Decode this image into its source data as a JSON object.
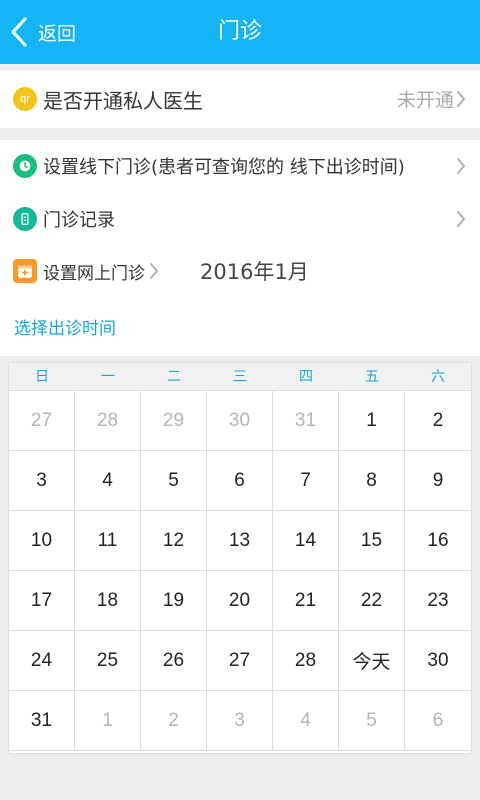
{
  "header": {
    "title": "门诊",
    "back_label": "返回"
  },
  "private_doctor": {
    "label": "是否开通私人医生",
    "status": "未开通",
    "icon_text": "qr"
  },
  "menu": {
    "offline_clinic": "设置线下门诊(患者可查询您的 线下出诊时间)",
    "records": "门诊记录",
    "online_clinic": "设置网上门诊",
    "month": "2016年1月",
    "select_time": "选择出诊时间"
  },
  "colors": {
    "accent": "#14b4f5",
    "link": "#14a4e0",
    "icon_yellow": "#f3c31b",
    "icon_green": "#19c07c",
    "icon_teal": "#17b89a",
    "icon_orange": "#f59a2a"
  },
  "calendar": {
    "weekdays": [
      "日",
      "一",
      "二",
      "三",
      "四",
      "五",
      "六"
    ],
    "days": [
      {
        "t": "27",
        "o": true
      },
      {
        "t": "28",
        "o": true
      },
      {
        "t": "29",
        "o": true
      },
      {
        "t": "30",
        "o": true
      },
      {
        "t": "31",
        "o": true
      },
      {
        "t": "1",
        "o": false
      },
      {
        "t": "2",
        "o": false
      },
      {
        "t": "3",
        "o": false
      },
      {
        "t": "4",
        "o": false
      },
      {
        "t": "5",
        "o": false
      },
      {
        "t": "6",
        "o": false
      },
      {
        "t": "7",
        "o": false
      },
      {
        "t": "8",
        "o": false
      },
      {
        "t": "9",
        "o": false
      },
      {
        "t": "10",
        "o": false
      },
      {
        "t": "11",
        "o": false
      },
      {
        "t": "12",
        "o": false
      },
      {
        "t": "13",
        "o": false
      },
      {
        "t": "14",
        "o": false
      },
      {
        "t": "15",
        "o": false
      },
      {
        "t": "16",
        "o": false
      },
      {
        "t": "17",
        "o": false
      },
      {
        "t": "18",
        "o": false
      },
      {
        "t": "19",
        "o": false
      },
      {
        "t": "20",
        "o": false
      },
      {
        "t": "21",
        "o": false
      },
      {
        "t": "22",
        "o": false
      },
      {
        "t": "23",
        "o": false
      },
      {
        "t": "24",
        "o": false
      },
      {
        "t": "25",
        "o": false
      },
      {
        "t": "26",
        "o": false
      },
      {
        "t": "27",
        "o": false
      },
      {
        "t": "28",
        "o": false
      },
      {
        "t": "今天",
        "o": false
      },
      {
        "t": "30",
        "o": false
      },
      {
        "t": "31",
        "o": false
      },
      {
        "t": "1",
        "o": true
      },
      {
        "t": "2",
        "o": true
      },
      {
        "t": "3",
        "o": true
      },
      {
        "t": "4",
        "o": true
      },
      {
        "t": "5",
        "o": true
      },
      {
        "t": "6",
        "o": true
      }
    ]
  }
}
